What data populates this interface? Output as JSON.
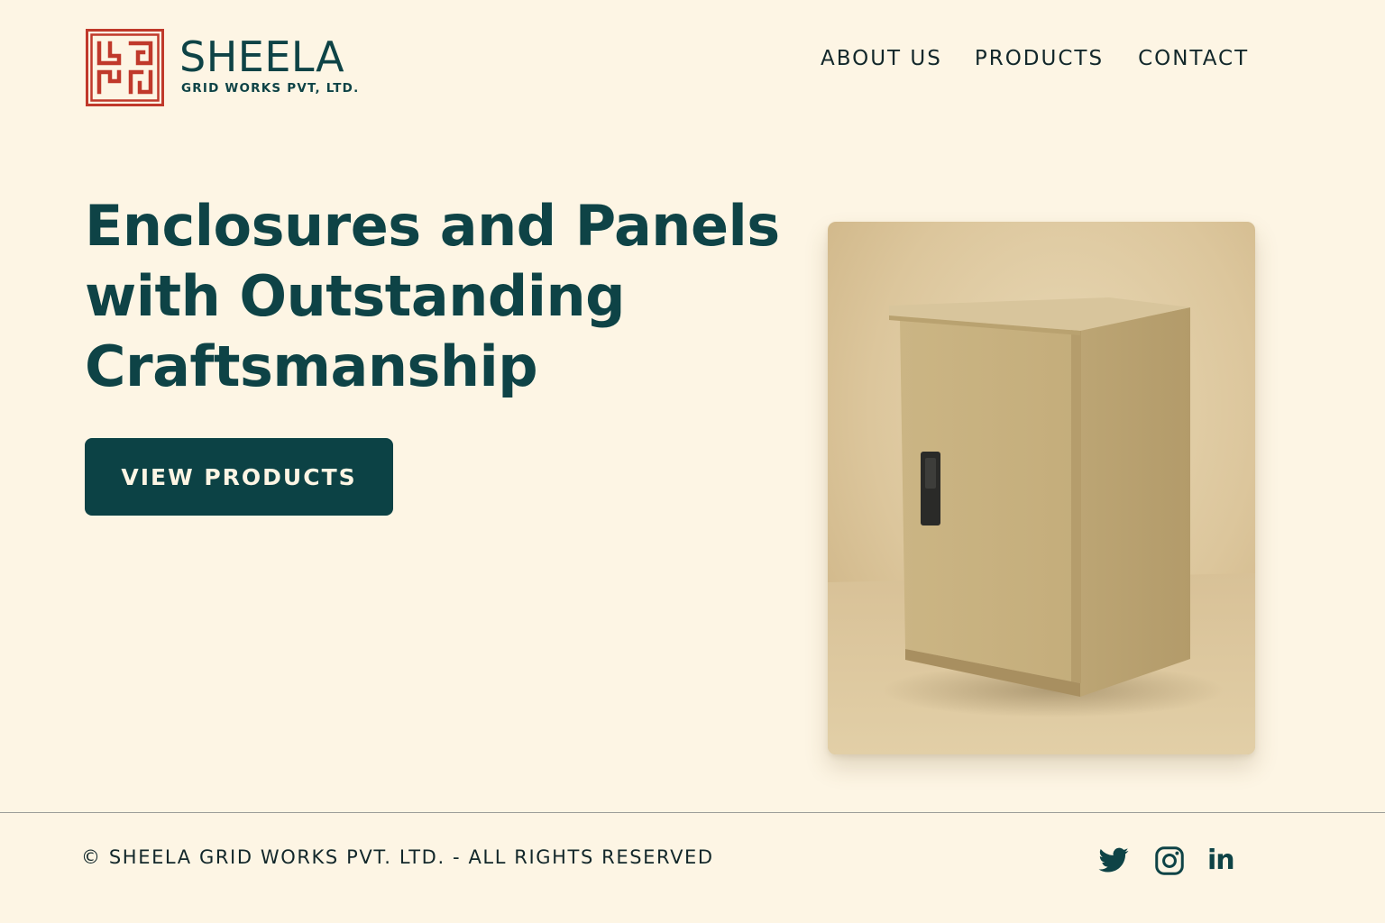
{
  "brand": {
    "name": "SHEELA",
    "subtitle": "GRID WORKS PVT, LTD.",
    "logo_icon": "meander-logo-icon",
    "logo_color": "#c0392b"
  },
  "nav": {
    "items": [
      {
        "label": "ABOUT US"
      },
      {
        "label": "PRODUCTS"
      },
      {
        "label": "CONTACT"
      }
    ]
  },
  "hero": {
    "headline_line1": "Enclosures and Panels",
    "headline_line2": "with Outstanding",
    "headline_line3": "Craftsmanship",
    "cta_label": "VIEW PRODUCTS",
    "image_subject": "beige-electrical-enclosure"
  },
  "footer": {
    "copyright": "© SHEELA GRID WORKS PVT. LTD. - ALL RIGHTS RESERVED",
    "social": [
      {
        "icon": "twitter-icon"
      },
      {
        "icon": "instagram-icon"
      },
      {
        "icon": "linkedin-icon",
        "text": "in"
      }
    ]
  },
  "colors": {
    "background": "#fdf5e4",
    "primary": "#0e4346",
    "accent_red": "#c0392b",
    "enclosure": "#c9b58a"
  }
}
